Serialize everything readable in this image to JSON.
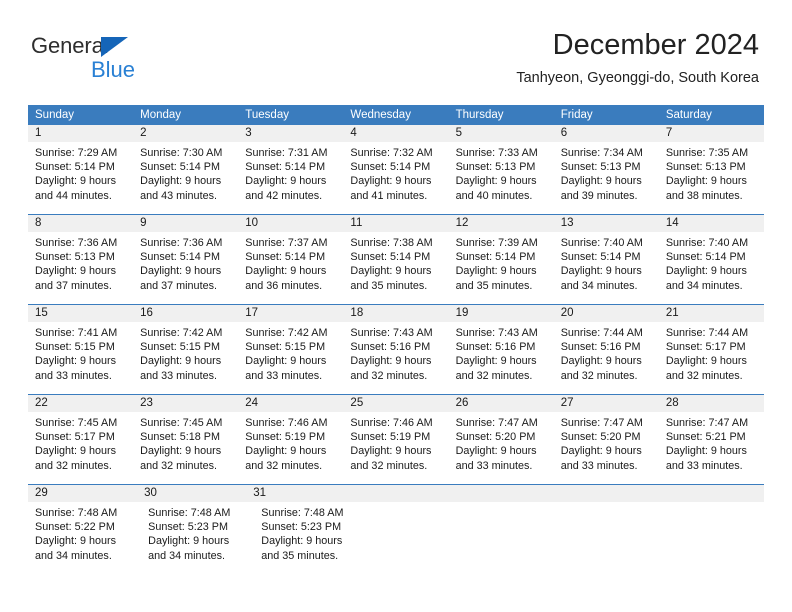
{
  "brand": {
    "name_part1": "General",
    "name_part2": "Blue",
    "colors": {
      "part1": "#2e2e2e",
      "part2": "#2980d4",
      "triangle": "#1565b8"
    }
  },
  "header": {
    "title": "December 2024",
    "location": "Tanhyeon, Gyeonggi-do, South Korea"
  },
  "calendar": {
    "header_bg": "#3a7cbe",
    "header_text_color": "#ffffff",
    "daynum_bg": "#f0f0f0",
    "weekdays": [
      "Sunday",
      "Monday",
      "Tuesday",
      "Wednesday",
      "Thursday",
      "Friday",
      "Saturday"
    ],
    "weeks": [
      {
        "days": [
          {
            "num": "1",
            "sunrise": "Sunrise: 7:29 AM",
            "sunset": "Sunset: 5:14 PM",
            "daylight1": "Daylight: 9 hours",
            "daylight2": "and 44 minutes."
          },
          {
            "num": "2",
            "sunrise": "Sunrise: 7:30 AM",
            "sunset": "Sunset: 5:14 PM",
            "daylight1": "Daylight: 9 hours",
            "daylight2": "and 43 minutes."
          },
          {
            "num": "3",
            "sunrise": "Sunrise: 7:31 AM",
            "sunset": "Sunset: 5:14 PM",
            "daylight1": "Daylight: 9 hours",
            "daylight2": "and 42 minutes."
          },
          {
            "num": "4",
            "sunrise": "Sunrise: 7:32 AM",
            "sunset": "Sunset: 5:14 PM",
            "daylight1": "Daylight: 9 hours",
            "daylight2": "and 41 minutes."
          },
          {
            "num": "5",
            "sunrise": "Sunrise: 7:33 AM",
            "sunset": "Sunset: 5:13 PM",
            "daylight1": "Daylight: 9 hours",
            "daylight2": "and 40 minutes."
          },
          {
            "num": "6",
            "sunrise": "Sunrise: 7:34 AM",
            "sunset": "Sunset: 5:13 PM",
            "daylight1": "Daylight: 9 hours",
            "daylight2": "and 39 minutes."
          },
          {
            "num": "7",
            "sunrise": "Sunrise: 7:35 AM",
            "sunset": "Sunset: 5:13 PM",
            "daylight1": "Daylight: 9 hours",
            "daylight2": "and 38 minutes."
          }
        ]
      },
      {
        "days": [
          {
            "num": "8",
            "sunrise": "Sunrise: 7:36 AM",
            "sunset": "Sunset: 5:13 PM",
            "daylight1": "Daylight: 9 hours",
            "daylight2": "and 37 minutes."
          },
          {
            "num": "9",
            "sunrise": "Sunrise: 7:36 AM",
            "sunset": "Sunset: 5:14 PM",
            "daylight1": "Daylight: 9 hours",
            "daylight2": "and 37 minutes."
          },
          {
            "num": "10",
            "sunrise": "Sunrise: 7:37 AM",
            "sunset": "Sunset: 5:14 PM",
            "daylight1": "Daylight: 9 hours",
            "daylight2": "and 36 minutes."
          },
          {
            "num": "11",
            "sunrise": "Sunrise: 7:38 AM",
            "sunset": "Sunset: 5:14 PM",
            "daylight1": "Daylight: 9 hours",
            "daylight2": "and 35 minutes."
          },
          {
            "num": "12",
            "sunrise": "Sunrise: 7:39 AM",
            "sunset": "Sunset: 5:14 PM",
            "daylight1": "Daylight: 9 hours",
            "daylight2": "and 35 minutes."
          },
          {
            "num": "13",
            "sunrise": "Sunrise: 7:40 AM",
            "sunset": "Sunset: 5:14 PM",
            "daylight1": "Daylight: 9 hours",
            "daylight2": "and 34 minutes."
          },
          {
            "num": "14",
            "sunrise": "Sunrise: 7:40 AM",
            "sunset": "Sunset: 5:14 PM",
            "daylight1": "Daylight: 9 hours",
            "daylight2": "and 34 minutes."
          }
        ]
      },
      {
        "days": [
          {
            "num": "15",
            "sunrise": "Sunrise: 7:41 AM",
            "sunset": "Sunset: 5:15 PM",
            "daylight1": "Daylight: 9 hours",
            "daylight2": "and 33 minutes."
          },
          {
            "num": "16",
            "sunrise": "Sunrise: 7:42 AM",
            "sunset": "Sunset: 5:15 PM",
            "daylight1": "Daylight: 9 hours",
            "daylight2": "and 33 minutes."
          },
          {
            "num": "17",
            "sunrise": "Sunrise: 7:42 AM",
            "sunset": "Sunset: 5:15 PM",
            "daylight1": "Daylight: 9 hours",
            "daylight2": "and 33 minutes."
          },
          {
            "num": "18",
            "sunrise": "Sunrise: 7:43 AM",
            "sunset": "Sunset: 5:16 PM",
            "daylight1": "Daylight: 9 hours",
            "daylight2": "and 32 minutes."
          },
          {
            "num": "19",
            "sunrise": "Sunrise: 7:43 AM",
            "sunset": "Sunset: 5:16 PM",
            "daylight1": "Daylight: 9 hours",
            "daylight2": "and 32 minutes."
          },
          {
            "num": "20",
            "sunrise": "Sunrise: 7:44 AM",
            "sunset": "Sunset: 5:16 PM",
            "daylight1": "Daylight: 9 hours",
            "daylight2": "and 32 minutes."
          },
          {
            "num": "21",
            "sunrise": "Sunrise: 7:44 AM",
            "sunset": "Sunset: 5:17 PM",
            "daylight1": "Daylight: 9 hours",
            "daylight2": "and 32 minutes."
          }
        ]
      },
      {
        "days": [
          {
            "num": "22",
            "sunrise": "Sunrise: 7:45 AM",
            "sunset": "Sunset: 5:17 PM",
            "daylight1": "Daylight: 9 hours",
            "daylight2": "and 32 minutes."
          },
          {
            "num": "23",
            "sunrise": "Sunrise: 7:45 AM",
            "sunset": "Sunset: 5:18 PM",
            "daylight1": "Daylight: 9 hours",
            "daylight2": "and 32 minutes."
          },
          {
            "num": "24",
            "sunrise": "Sunrise: 7:46 AM",
            "sunset": "Sunset: 5:19 PM",
            "daylight1": "Daylight: 9 hours",
            "daylight2": "and 32 minutes."
          },
          {
            "num": "25",
            "sunrise": "Sunrise: 7:46 AM",
            "sunset": "Sunset: 5:19 PM",
            "daylight1": "Daylight: 9 hours",
            "daylight2": "and 32 minutes."
          },
          {
            "num": "26",
            "sunrise": "Sunrise: 7:47 AM",
            "sunset": "Sunset: 5:20 PM",
            "daylight1": "Daylight: 9 hours",
            "daylight2": "and 33 minutes."
          },
          {
            "num": "27",
            "sunrise": "Sunrise: 7:47 AM",
            "sunset": "Sunset: 5:20 PM",
            "daylight1": "Daylight: 9 hours",
            "daylight2": "and 33 minutes."
          },
          {
            "num": "28",
            "sunrise": "Sunrise: 7:47 AM",
            "sunset": "Sunset: 5:21 PM",
            "daylight1": "Daylight: 9 hours",
            "daylight2": "and 33 minutes."
          }
        ]
      },
      {
        "days": [
          {
            "num": "29",
            "sunrise": "Sunrise: 7:48 AM",
            "sunset": "Sunset: 5:22 PM",
            "daylight1": "Daylight: 9 hours",
            "daylight2": "and 34 minutes."
          },
          {
            "num": "30",
            "sunrise": "Sunrise: 7:48 AM",
            "sunset": "Sunset: 5:23 PM",
            "daylight1": "Daylight: 9 hours",
            "daylight2": "and 34 minutes."
          },
          {
            "num": "31",
            "sunrise": "Sunrise: 7:48 AM",
            "sunset": "Sunset: 5:23 PM",
            "daylight1": "Daylight: 9 hours",
            "daylight2": "and 35 minutes."
          }
        ]
      }
    ]
  }
}
